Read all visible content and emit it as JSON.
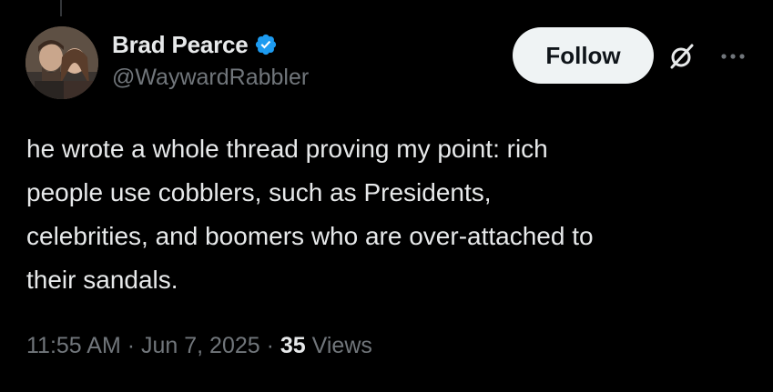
{
  "author": {
    "display_name": "Brad Pearce",
    "handle": "@WaywardRabbler",
    "verified": true,
    "verified_color": "#1d9bf0",
    "avatar_icon": "profile-photo"
  },
  "actions": {
    "follow_label": "Follow",
    "grok_icon": "grok-icon",
    "more_icon": "more-horizontal-icon"
  },
  "tweet": {
    "lines": [
      "he wrote a whole thread proving my point: rich",
      "people use cobblers, such as Presidents,",
      "celebrities, and boomers who are over-attached to",
      "their sandals."
    ]
  },
  "meta": {
    "time": "11:55 AM",
    "separator_1": " · ",
    "date": "Jun 7, 2025",
    "separator_2": " · ",
    "views_count": "35",
    "views_label": " Views"
  },
  "colors": {
    "background": "#000000",
    "text_primary": "#e7e9ea",
    "text_secondary": "#71767b",
    "follow_bg": "#eff3f4",
    "follow_text": "#0f1419"
  }
}
